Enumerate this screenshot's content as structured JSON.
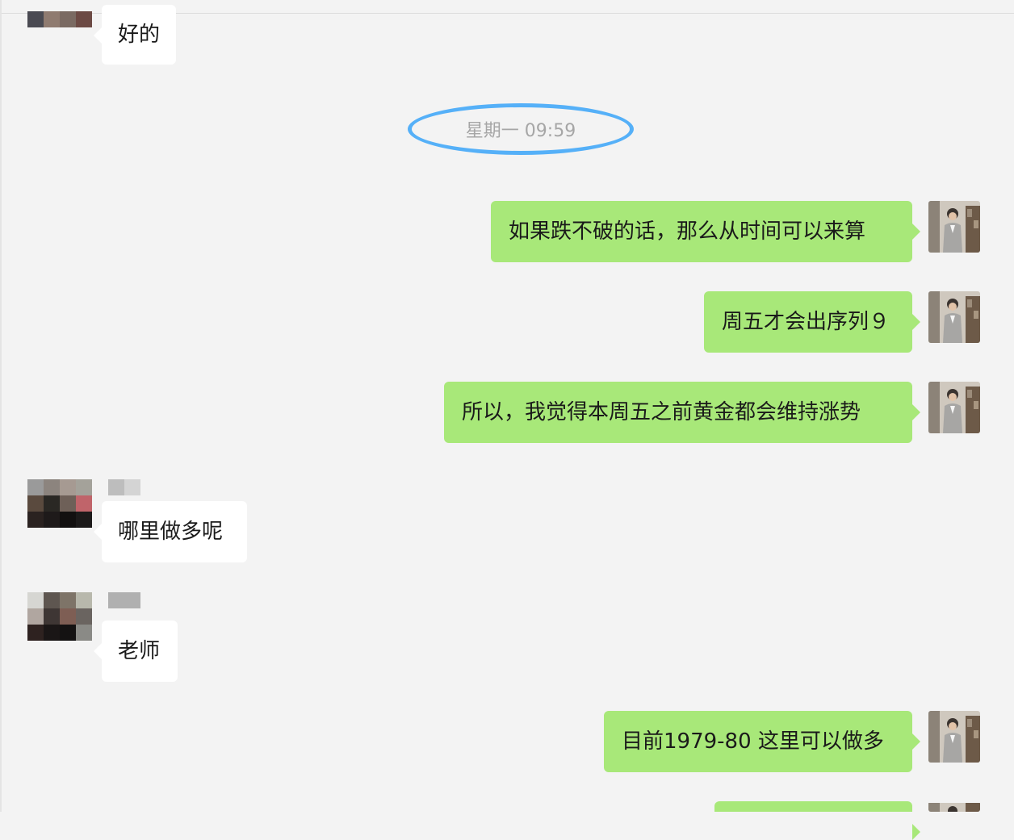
{
  "timestamp": "星期一 09:59",
  "messages": [
    {
      "side": "in",
      "text": "好的"
    },
    {
      "side": "out",
      "text": "如果跌不破的话，那么从时间可以来算"
    },
    {
      "side": "out",
      "text": "周五才会出序列９"
    },
    {
      "side": "out",
      "text": "所以，我觉得本周五之前黄金都会维持涨势"
    },
    {
      "side": "in",
      "text": "哪里做多呢"
    },
    {
      "side": "in",
      "text": "老师"
    },
    {
      "side": "out",
      "text": "目前1979-80 这里可以做多"
    }
  ],
  "colors": {
    "outgoing_bubble": "#a8e879",
    "incoming_bubble": "#ffffff",
    "timestamp_circle": "#55b0f8",
    "background": "#f3f3f3"
  }
}
